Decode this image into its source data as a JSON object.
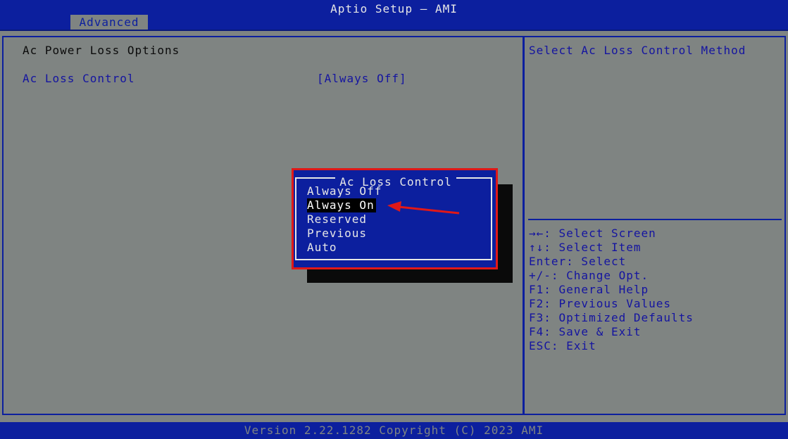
{
  "header": {
    "app_title": "Aptio Setup – AMI",
    "tab_label": "Advanced"
  },
  "main": {
    "section_title": "Ac Power Loss Options",
    "setting": {
      "label": "Ac Loss Control",
      "value": "[Always Off]"
    }
  },
  "help": {
    "description": "Select Ac Loss Control Method",
    "keys": [
      "→←: Select Screen",
      "↑↓: Select Item",
      "Enter: Select",
      "+/-: Change Opt.",
      "F1: General Help",
      "F2: Previous Values",
      "F3: Optimized Defaults",
      "F4: Save & Exit",
      "ESC: Exit"
    ]
  },
  "popup": {
    "title": "Ac Loss Control",
    "options": [
      "Always Off",
      "Always On",
      "Reserved",
      "Previous",
      "Auto"
    ],
    "selected_index": 1
  },
  "footer": {
    "version": "Version 2.22.1282 Copyright (C) 2023 AMI"
  },
  "colors": {
    "background": "#7f8482",
    "bios_blue": "#0c1f9e",
    "highlight_red": "#e01818"
  }
}
